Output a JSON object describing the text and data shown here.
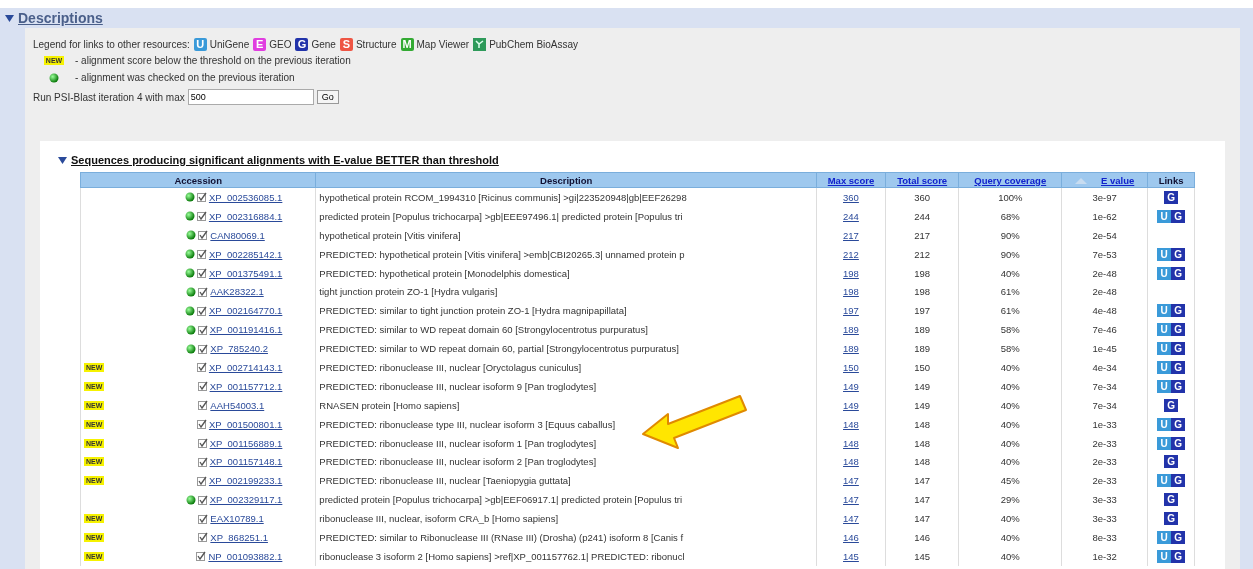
{
  "section": {
    "title": "Descriptions",
    "expanded": true
  },
  "legend": {
    "label": "Legend for links to other resources:",
    "items": [
      {
        "letter": "U",
        "label": "UniGene",
        "color": "#3a9ad9"
      },
      {
        "letter": "E",
        "label": "GEO",
        "color": "#e03ee0"
      },
      {
        "letter": "G",
        "label": "Gene",
        "color": "#2233aa"
      },
      {
        "letter": "S",
        "label": "Structure",
        "color": "#ee5544"
      },
      {
        "letter": "M",
        "label": "Map Viewer",
        "color": "#33aa33"
      },
      {
        "label": "PubChem BioAssay",
        "color": "#2e9a5a"
      }
    ],
    "notes": [
      {
        "kind": "new",
        "badge": "NEW",
        "text": "- alignment score below the threshold on the previous iteration"
      },
      {
        "kind": "checked",
        "text": "- alignment was checked on the previous iteration"
      }
    ]
  },
  "run": {
    "label": "Run PSI-Blast iteration 4 with max",
    "value": "500",
    "button": "Go"
  },
  "subsection": {
    "title": "Sequences producing significant alignments with E-value BETTER than threshold",
    "expanded": true
  },
  "table": {
    "columns": [
      {
        "label": "Accession",
        "link": false,
        "sorted": false
      },
      {
        "label": "Description",
        "link": false,
        "sorted": false
      },
      {
        "label": "Max score",
        "link": true,
        "sorted": false
      },
      {
        "label": "Total score",
        "link": true,
        "sorted": false
      },
      {
        "label": "Query coverage",
        "link": true,
        "sorted": false
      },
      {
        "label": "E value",
        "link": true,
        "sorted": true
      },
      {
        "label": "Links",
        "link": false,
        "sorted": false
      }
    ],
    "rows": [
      {
        "kind": "checked",
        "selected": true,
        "accession": "XP_002536085.1",
        "description": "hypothetical protein RCOM_1994310 [Ricinus communis] >gi|223520948|gb|EEF26298",
        "max_score": "360",
        "total_score": "360",
        "coverage": "100%",
        "e_value": "3e-97",
        "links": [
          "G"
        ]
      },
      {
        "kind": "checked",
        "selected": true,
        "accession": "XP_002316884.1",
        "description": "predicted protein [Populus trichocarpa] >gb|EEE97496.1| predicted protein [Populus tri",
        "max_score": "244",
        "total_score": "244",
        "coverage": "68%",
        "e_value": "1e-62",
        "links": [
          "U",
          "G"
        ]
      },
      {
        "kind": "checked",
        "selected": true,
        "accession": "CAN80069.1",
        "description": "hypothetical protein [Vitis vinifera]",
        "max_score": "217",
        "total_score": "217",
        "coverage": "90%",
        "e_value": "2e-54",
        "links": []
      },
      {
        "kind": "checked",
        "selected": true,
        "accession": "XP_002285142.1",
        "description": "PREDICTED: hypothetical protein [Vitis vinifera] >emb|CBI20265.3| unnamed protein p",
        "max_score": "212",
        "total_score": "212",
        "coverage": "90%",
        "e_value": "7e-53",
        "links": [
          "U",
          "G"
        ]
      },
      {
        "kind": "checked",
        "selected": true,
        "accession": "XP_001375491.1",
        "description": "PREDICTED: hypothetical protein [Monodelphis domestica]",
        "max_score": "198",
        "total_score": "198",
        "coverage": "40%",
        "e_value": "2e-48",
        "links": [
          "U",
          "G"
        ]
      },
      {
        "kind": "checked",
        "selected": true,
        "accession": "AAK28322.1",
        "description": "tight junction protein ZO-1 [Hydra vulgaris]",
        "max_score": "198",
        "total_score": "198",
        "coverage": "61%",
        "e_value": "2e-48",
        "links": []
      },
      {
        "kind": "checked",
        "selected": true,
        "accession": "XP_002164770.1",
        "description": "PREDICTED: similar to tight junction protein ZO-1 [Hydra magnipapillata]",
        "max_score": "197",
        "total_score": "197",
        "coverage": "61%",
        "e_value": "4e-48",
        "links": [
          "U",
          "G"
        ]
      },
      {
        "kind": "checked",
        "selected": true,
        "accession": "XP_001191416.1",
        "description": "PREDICTED: similar to WD repeat domain 60 [Strongylocentrotus purpuratus]",
        "max_score": "189",
        "total_score": "189",
        "coverage": "58%",
        "e_value": "7e-46",
        "links": [
          "U",
          "G"
        ]
      },
      {
        "kind": "checked",
        "selected": true,
        "accession": "XP_785240.2",
        "description": "PREDICTED: similar to WD repeat domain 60, partial [Strongylocentrotus purpuratus]",
        "max_score": "189",
        "total_score": "189",
        "coverage": "58%",
        "e_value": "1e-45",
        "links": [
          "U",
          "G"
        ]
      },
      {
        "kind": "new",
        "badge": "NEW",
        "selected": true,
        "accession": "XP_002714143.1",
        "description": "PREDICTED: ribonuclease III, nuclear [Oryctolagus cuniculus]",
        "max_score": "150",
        "total_score": "150",
        "coverage": "40%",
        "e_value": "4e-34",
        "links": [
          "U",
          "G"
        ]
      },
      {
        "kind": "new",
        "badge": "NEW",
        "selected": true,
        "accession": "XP_001157712.1",
        "description": "PREDICTED: ribonuclease III, nuclear isoform 9 [Pan troglodytes]",
        "max_score": "149",
        "total_score": "149",
        "coverage": "40%",
        "e_value": "7e-34",
        "links": [
          "U",
          "G"
        ]
      },
      {
        "kind": "new",
        "badge": "NEW",
        "selected": true,
        "accession": "AAH54003.1",
        "description": "RNASEN protein [Homo sapiens]",
        "max_score": "149",
        "total_score": "149",
        "coverage": "40%",
        "e_value": "7e-34",
        "links": [
          "G"
        ]
      },
      {
        "kind": "new",
        "badge": "NEW",
        "selected": true,
        "accession": "XP_001500801.1",
        "description": "PREDICTED: ribonuclease type III, nuclear isoform 3 [Equus caballus]",
        "max_score": "148",
        "total_score": "148",
        "coverage": "40%",
        "e_value": "1e-33",
        "links": [
          "U",
          "G"
        ]
      },
      {
        "kind": "new",
        "badge": "NEW",
        "selected": true,
        "accession": "XP_001156889.1",
        "description": "PREDICTED: ribonuclease III, nuclear isoform 1 [Pan troglodytes]",
        "max_score": "148",
        "total_score": "148",
        "coverage": "40%",
        "e_value": "2e-33",
        "links": [
          "U",
          "G"
        ]
      },
      {
        "kind": "new",
        "badge": "NEW",
        "selected": true,
        "accession": "XP_001157148.1",
        "description": "PREDICTED: ribonuclease III, nuclear isoform 2 [Pan troglodytes]",
        "max_score": "148",
        "total_score": "148",
        "coverage": "40%",
        "e_value": "2e-33",
        "links": [
          "G"
        ]
      },
      {
        "kind": "new",
        "badge": "NEW",
        "selected": true,
        "accession": "XP_002199233.1",
        "description": "PREDICTED: ribonuclease III, nuclear [Taeniopygia guttata]",
        "max_score": "147",
        "total_score": "147",
        "coverage": "45%",
        "e_value": "2e-33",
        "links": [
          "U",
          "G"
        ]
      },
      {
        "kind": "checked",
        "selected": true,
        "accession": "XP_002329117.1",
        "description": "predicted protein [Populus trichocarpa] >gb|EEF06917.1| predicted protein [Populus tri",
        "max_score": "147",
        "total_score": "147",
        "coverage": "29%",
        "e_value": "3e-33",
        "links": [
          "G"
        ]
      },
      {
        "kind": "new",
        "badge": "NEW",
        "selected": true,
        "accession": "EAX10789.1",
        "description": "ribonuclease III, nuclear, isoform CRA_b [Homo sapiens]",
        "max_score": "147",
        "total_score": "147",
        "coverage": "40%",
        "e_value": "3e-33",
        "links": [
          "G"
        ]
      },
      {
        "kind": "new",
        "badge": "NEW",
        "selected": true,
        "accession": "XP_868251.1",
        "description": "PREDICTED: similar to Ribonuclease III (RNase III) (Drosha) (p241) isoform 8 [Canis f",
        "max_score": "146",
        "total_score": "146",
        "coverage": "40%",
        "e_value": "8e-33",
        "links": [
          "U",
          "G"
        ]
      },
      {
        "kind": "new",
        "badge": "NEW",
        "selected": true,
        "accession": "NP_001093882.1",
        "description": "ribonuclease 3 isoform 2 [Homo sapiens] >ref|XP_001157762.1| PREDICTED: ribonucl",
        "max_score": "145",
        "total_score": "145",
        "coverage": "40%",
        "e_value": "1e-32",
        "links": [
          "U",
          "G"
        ]
      }
    ]
  }
}
